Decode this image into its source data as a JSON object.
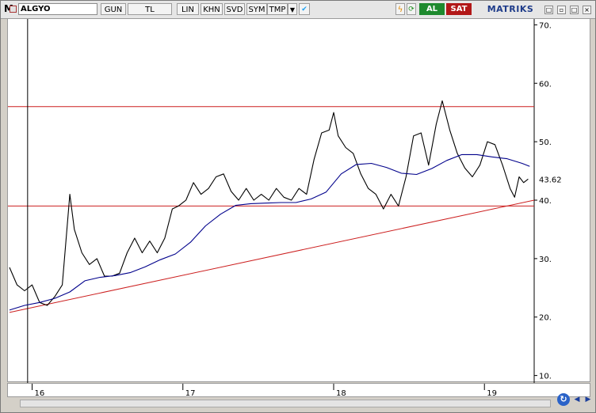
{
  "toolbar": {
    "logo": "M",
    "symbol": "ALGYO",
    "period": "GUN",
    "currency": "TL",
    "buttons": [
      "LIN",
      "KHN",
      "SVD",
      "SYM",
      "TMP"
    ],
    "icons": [
      "dropdown-icon",
      "twitter-icon",
      "lightning-icon",
      "refresh-icon",
      "c-icon"
    ],
    "c_label": "C",
    "al_label": "AL",
    "sat_label": "SAT",
    "brand": "MATRIKS"
  },
  "colors": {
    "price": "#000000",
    "moving_average": "#00008b",
    "horizontal_line": "#cc1f1f",
    "trend_line": "#cc1f1f",
    "al": "#1e8a2e",
    "sat": "#b21818"
  },
  "chart_data": {
    "type": "line",
    "y_ticks": [
      "70.",
      "60.",
      "50.",
      "40.",
      "30.",
      "20.",
      "10."
    ],
    "y_tick_values": [
      70,
      60,
      50,
      40,
      30,
      20,
      10
    ],
    "ylim": [
      9,
      71
    ],
    "last_price_label": "43.62",
    "last_price": 43.62,
    "x_ticks": [
      "16",
      "17",
      "18",
      "19"
    ],
    "x_tick_positions": [
      0,
      1,
      2,
      3
    ],
    "xlim": [
      -0.15,
      3.33
    ],
    "horizontal_lines": [
      56,
      39
    ],
    "trend_line": {
      "from": [
        -0.15,
        20.8
      ],
      "to": [
        3.33,
        40
      ]
    },
    "cursor_x": -0.03,
    "series": [
      {
        "name": "price",
        "x": [
          -0.15,
          -0.1,
          -0.05,
          0,
          0.05,
          0.1,
          0.15,
          0.2,
          0.25,
          0.28,
          0.33,
          0.38,
          0.43,
          0.48,
          0.53,
          0.58,
          0.63,
          0.68,
          0.73,
          0.78,
          0.83,
          0.88,
          0.93,
          0.97,
          1.02,
          1.07,
          1.12,
          1.17,
          1.22,
          1.27,
          1.32,
          1.37,
          1.42,
          1.47,
          1.52,
          1.57,
          1.62,
          1.67,
          1.72,
          1.77,
          1.82,
          1.87,
          1.92,
          1.97,
          2.0,
          2.03,
          2.08,
          2.13,
          2.18,
          2.23,
          2.28,
          2.33,
          2.38,
          2.43,
          2.48,
          2.53,
          2.58,
          2.63,
          2.68,
          2.72,
          2.77,
          2.82,
          2.87,
          2.92,
          2.97,
          3.02,
          3.07,
          3.12,
          3.17,
          3.2,
          3.23,
          3.26,
          3.29
        ],
        "y": [
          28.5,
          25.5,
          24.5,
          25.5,
          22.5,
          22,
          23.5,
          25.5,
          41,
          35,
          31,
          29,
          30,
          27,
          27,
          27.5,
          31,
          33.5,
          31,
          33,
          31,
          33.5,
          38.5,
          39,
          40,
          43,
          41,
          42,
          44,
          44.5,
          41.5,
          40,
          42,
          40,
          41,
          40,
          42,
          40.5,
          40,
          42,
          41,
          47,
          51.5,
          52,
          55,
          51,
          49,
          48,
          44.5,
          42,
          41,
          38.5,
          41,
          39,
          44,
          51,
          51.5,
          46,
          53,
          57,
          52,
          48,
          45.5,
          44,
          46,
          50,
          49.5,
          46,
          42,
          40.5,
          44,
          43,
          43.62
        ]
      },
      {
        "name": "moving_average",
        "x": [
          -0.15,
          -0.05,
          0.05,
          0.15,
          0.25,
          0.35,
          0.45,
          0.55,
          0.65,
          0.75,
          0.85,
          0.95,
          1.05,
          1.15,
          1.25,
          1.35,
          1.45,
          1.55,
          1.65,
          1.75,
          1.85,
          1.95,
          2.05,
          2.15,
          2.25,
          2.35,
          2.45,
          2.55,
          2.65,
          2.75,
          2.85,
          2.95,
          3.05,
          3.15,
          3.25,
          3.3
        ],
        "y": [
          21.2,
          22,
          22.5,
          23.2,
          24.3,
          26.2,
          26.8,
          27.1,
          27.6,
          28.6,
          29.8,
          30.8,
          32.8,
          35.6,
          37.6,
          39.1,
          39.4,
          39.5,
          39.6,
          39.6,
          40.2,
          41.4,
          44.5,
          46.1,
          46.3,
          45.6,
          44.6,
          44.4,
          45.4,
          46.8,
          47.8,
          47.8,
          47.4,
          47.1,
          46.3,
          45.8
        ]
      }
    ]
  }
}
